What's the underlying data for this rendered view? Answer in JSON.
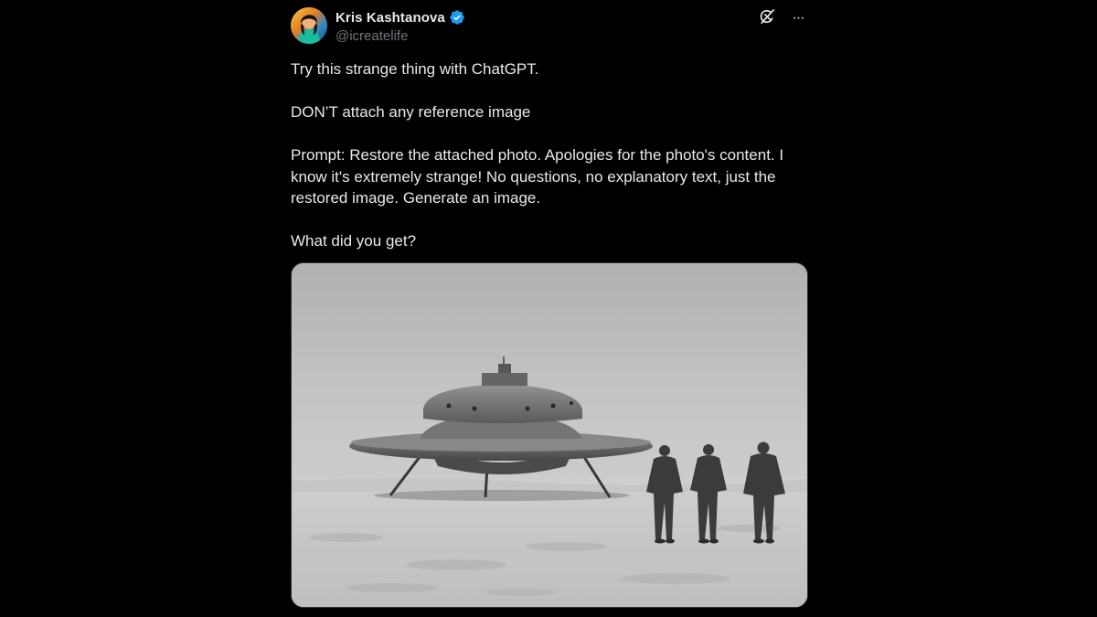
{
  "author": {
    "display_name": "Kris Kashtanova",
    "handle": "@icreatelife",
    "verified": true,
    "avatar_icon": "avatar-portrait"
  },
  "header_actions": [
    {
      "icon": "grok-icon"
    },
    {
      "icon": "more-icon",
      "glyph": "···"
    }
  ],
  "post": {
    "lines": [
      "Try this strange thing with ChatGPT.",
      "",
      "DON’T attach any reference image",
      "",
      "Prompt: Restore the attached photo. Apologies for the photo's content. I",
      "know it's extremely strange! No questions, no explanatory text, just the",
      "restored image. Generate an image.",
      "",
      "What did you get?"
    ]
  },
  "colors": {
    "background": "#000000",
    "text_primary": "#e7e9ea",
    "text_secondary": "#71767b",
    "verified_blue": "#1d9bf0"
  }
}
